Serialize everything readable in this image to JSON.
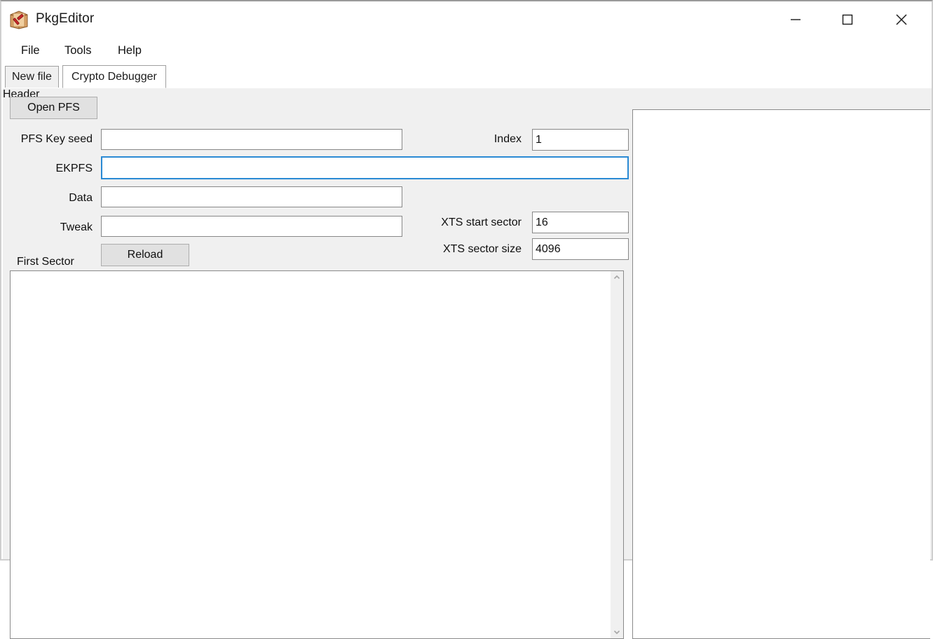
{
  "window": {
    "title": "PkgEditor",
    "icon": "package-hammer-icon",
    "controls": {
      "minimize": "minimize-icon",
      "maximize": "maximize-icon",
      "close": "close-icon"
    }
  },
  "menubar": {
    "items": [
      {
        "label": "File"
      },
      {
        "label": "Tools"
      },
      {
        "label": "Help"
      }
    ]
  },
  "tabs": [
    {
      "label": "New file",
      "active": false
    },
    {
      "label": "Crypto Debugger",
      "active": true
    }
  ],
  "crypto_debugger": {
    "open_pfs_button": "Open PFS",
    "reload_button": "Reload",
    "fields": {
      "pfs_key_seed": {
        "label": "PFS Key seed",
        "value": "",
        "placeholder": ""
      },
      "ekpfs": {
        "label": "EKPFS",
        "value": "",
        "placeholder": "",
        "focused": true
      },
      "data": {
        "label": "Data",
        "value": "",
        "placeholder": ""
      },
      "tweak": {
        "label": "Tweak",
        "value": "",
        "placeholder": ""
      },
      "index": {
        "label": "Index",
        "value": "1",
        "placeholder": ""
      },
      "xts_start_sector": {
        "label": "XTS start sector",
        "value": "16",
        "placeholder": ""
      },
      "xts_sector_size": {
        "label": "XTS sector size",
        "value": "4096",
        "placeholder": ""
      }
    },
    "first_sector": {
      "label": "First Sector",
      "value": "",
      "scrollbar": {
        "up_arrow": "chevron-up-icon",
        "down_arrow": "chevron-down-icon"
      }
    },
    "header_panel": {
      "label": "Header",
      "value": ""
    }
  },
  "colors": {
    "window_background": "#ffffff",
    "client_background": "#f0f0f0",
    "button_face": "#e1e1e1",
    "button_border": "#adadad",
    "input_border": "#888888",
    "focus_border": "#2a8ad4",
    "text": "#0f0f0f",
    "tab_border": "#a0a0a0"
  }
}
